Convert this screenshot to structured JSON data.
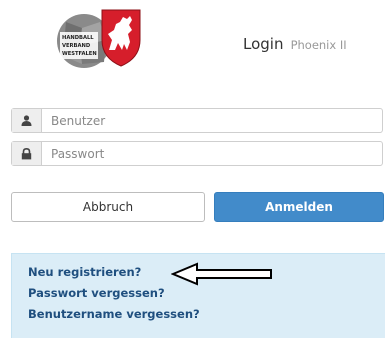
{
  "logo": {
    "text_lines": [
      "HANDBALL",
      "VERBAND",
      "WESTFALEN"
    ]
  },
  "header": {
    "title": "Login",
    "subtitle": "Phoenix II"
  },
  "form": {
    "username_placeholder": "Benutzer",
    "password_placeholder": "Passwort",
    "cancel_label": "Abbruch",
    "login_label": "Anmelden"
  },
  "links": {
    "register": "Neu registrieren?",
    "forgot_password": "Passwort vergessen?",
    "forgot_username": "Benutzername vergessen?"
  },
  "colors": {
    "primary_button": "#428bca",
    "links_background": "#dbedf7",
    "link_text": "#1f4f7f",
    "logo_red": "#d61e2b"
  }
}
